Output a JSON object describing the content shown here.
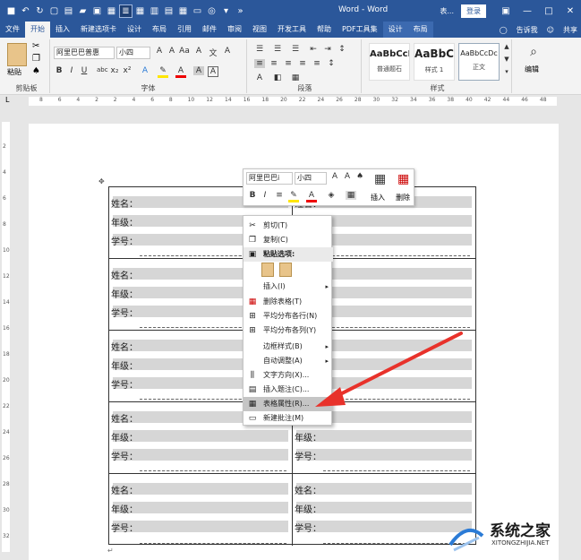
{
  "title": "Word - Word",
  "title_short": "表...",
  "login_label": "登录",
  "tabs": [
    "文件",
    "开始",
    "插入",
    "新建选项卡",
    "设计",
    "布局",
    "引用",
    "邮件",
    "审阅",
    "视图",
    "开发工具",
    "帮助",
    "PDF工具集",
    "设计",
    "布局"
  ],
  "tell_me": "告诉我",
  "share": "共享",
  "ribbon": {
    "paste_label": "粘贴",
    "clipboard_label": "剪贴板",
    "font_name": "阿里巴巴普惠",
    "font_size": "小四",
    "font_label": "字体",
    "paragraph_label": "段落",
    "styles_label": "样式",
    "editing_label": "编辑",
    "styles": [
      {
        "preview": "AaBbCcI",
        "name": "普通题石"
      },
      {
        "preview": "AaBbC",
        "name": "样式 1"
      },
      {
        "preview": "AaBbCcDc",
        "name": "正文"
      }
    ]
  },
  "ruler_numbers": [
    "8",
    "6",
    "4",
    "2",
    "2",
    "4",
    "6",
    "8",
    "10",
    "12",
    "14",
    "16",
    "18",
    "20",
    "22",
    "24",
    "26",
    "28",
    "30",
    "32",
    "34",
    "36",
    "38",
    "40",
    "42",
    "44",
    "46",
    "48"
  ],
  "vruler_numbers": [
    "2",
    "4",
    "6",
    "8",
    "10",
    "12",
    "14",
    "16",
    "18",
    "20",
    "22",
    "24",
    "26",
    "28",
    "30",
    "32"
  ],
  "labels": [
    "姓名：",
    "年级：",
    "学号："
  ],
  "minitoolbar": {
    "font": "阿里巴巴i",
    "size": "小四",
    "insert": "插入",
    "delete": "删除"
  },
  "context_menu": {
    "cut": "剪切(T)",
    "copy": "复制(C)",
    "paste_options": "粘贴选项:",
    "insert": "插入(I)",
    "delete_table": "删除表格(T)",
    "distribute_rows": "平均分布各行(N)",
    "distribute_cols": "平均分布各列(Y)",
    "border_styles": "边框样式(B)",
    "autofit": "自动调整(A)",
    "text_direction": "文字方向(X)...",
    "insert_caption": "插入题注(C)...",
    "table_properties": "表格属性(R)...",
    "new_comment": "新建批注(M)"
  },
  "watermark": {
    "name": "系统之家",
    "url": "XITONGZHIJIA.NET"
  },
  "colors": {
    "word_blue": "#2b579a",
    "arrow_red": "#e8322b"
  }
}
